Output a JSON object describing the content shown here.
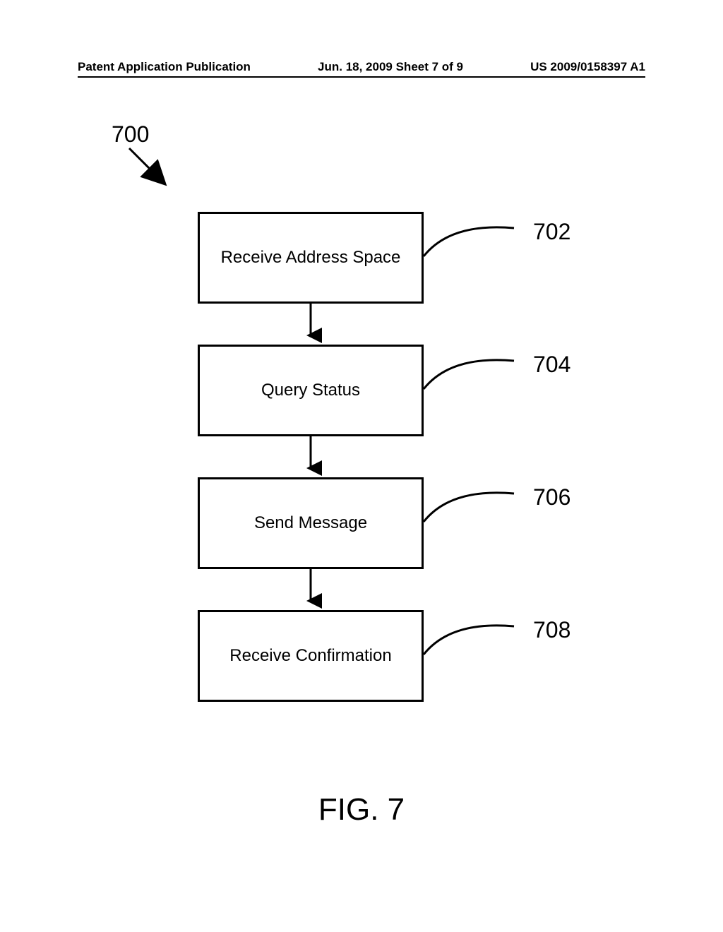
{
  "header": {
    "left": "Patent Application Publication",
    "center": "Jun. 18, 2009  Sheet 7 of 9",
    "right": "US 2009/0158397 A1"
  },
  "ref": {
    "number": "700"
  },
  "boxes": [
    {
      "label": "Receive Address Space",
      "num": "702"
    },
    {
      "label": "Query Status",
      "num": "704"
    },
    {
      "label": "Send Message",
      "num": "706"
    },
    {
      "label": "Receive Confirmation",
      "num": "708"
    }
  ],
  "caption": "FIG. 7"
}
